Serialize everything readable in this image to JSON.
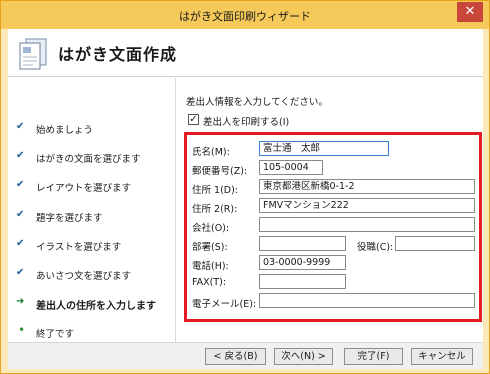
{
  "window": {
    "title": "はがき文面印刷ウィザード",
    "close_label": "✕"
  },
  "header": {
    "title": "はがき文面作成",
    "icon": "postcard-icon"
  },
  "sidebar": {
    "steps": [
      {
        "label": "始めましょう",
        "state": "done",
        "mark": "✔"
      },
      {
        "label": "はがきの文面を選びます",
        "state": "done",
        "mark": "✔"
      },
      {
        "label": "レイアウトを選びます",
        "state": "done",
        "mark": "✔"
      },
      {
        "label": "題字を選びます",
        "state": "done",
        "mark": "✔"
      },
      {
        "label": "イラストを選びます",
        "state": "done",
        "mark": "✔"
      },
      {
        "label": "あいさつ文を選びます",
        "state": "done",
        "mark": "✔"
      },
      {
        "label": "差出人の住所を入力します",
        "state": "current",
        "mark": "➜"
      },
      {
        "label": "終了です",
        "state": "pending",
        "mark": "•"
      }
    ]
  },
  "main": {
    "instruction": "差出人情報を入力してください。",
    "print_sender": {
      "label": "差出人を印刷する(I)",
      "checked": true,
      "check_mark": "✓"
    },
    "fields": {
      "name": {
        "label": "氏名(M):",
        "value": "富士通　太郎"
      },
      "postal": {
        "label": "郵便番号(Z):",
        "value": "105-0004"
      },
      "address1": {
        "label": "住所 1(D):",
        "value": "東京都港区新橋0-1-2"
      },
      "address2": {
        "label": "住所 2(R):",
        "value": "FMVマンション222"
      },
      "company": {
        "label": "会社(O):",
        "value": ""
      },
      "department": {
        "label": "部署(S):",
        "value": ""
      },
      "position": {
        "label": "役職(C):",
        "value": ""
      },
      "phone": {
        "label": "電話(H):",
        "value": "03-0000-9999"
      },
      "fax": {
        "label": "FAX(T):",
        "value": ""
      },
      "email": {
        "label": "電子メール(E):",
        "value": ""
      }
    }
  },
  "footer": {
    "back": "< 戻る(B)",
    "next": "次へ(N) >",
    "finish": "完了(F)",
    "cancel": "キャンセル"
  },
  "colors": {
    "frame": "#f5c95a",
    "highlight_box": "#e31b23",
    "close": "#c8463a"
  }
}
